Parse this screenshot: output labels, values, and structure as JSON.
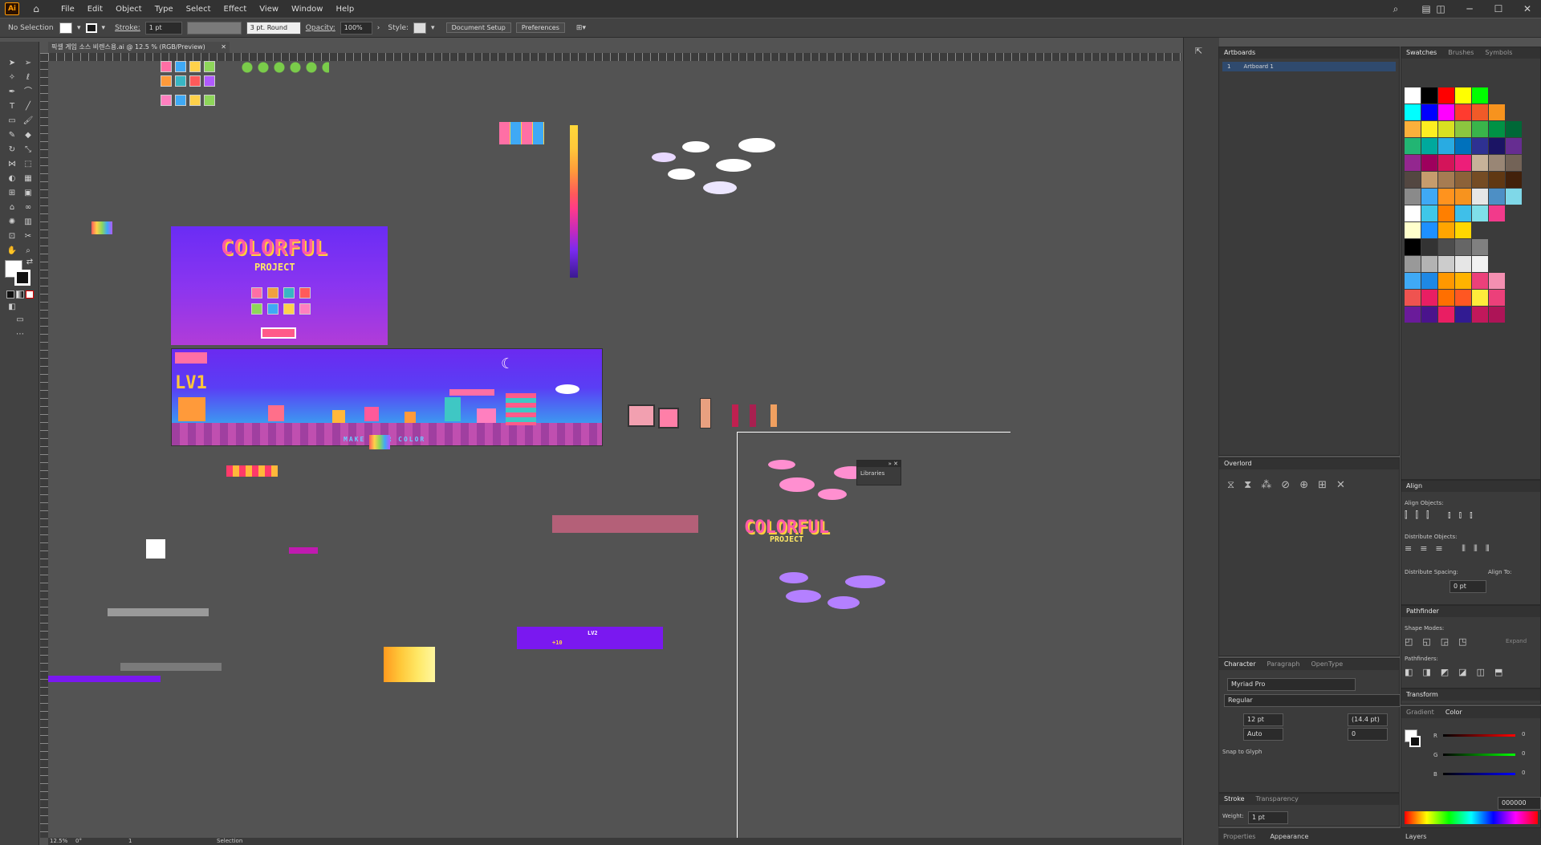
{
  "menubar": {
    "app_icon": "Ai",
    "items": [
      "File",
      "Edit",
      "Object",
      "Type",
      "Select",
      "Effect",
      "View",
      "Window",
      "Help"
    ],
    "right_icons": [
      "search-icon",
      "arrange-icon",
      "workspace-icon",
      "minimize-icon",
      "maximize-icon",
      "close-icon"
    ]
  },
  "control": {
    "selection": "No Selection",
    "stroke_label": "Stroke:",
    "stroke_value": "1 pt",
    "brush": "3 pt. Round",
    "opacity_label": "Opacity:",
    "opacity_value": "100%",
    "style_label": "Style:",
    "doc_setup": "Document Setup",
    "preferences": "Preferences"
  },
  "document": {
    "tab_title": "픽셀 게임 소스 비렌스용.ai @ 12.5 % (RGB/Preview)",
    "zoom": "12.5%",
    "rotation": "0°",
    "artboard_nav": "1",
    "status": "Selection"
  },
  "artboards_panel": {
    "title": "Artboards",
    "rows": [
      {
        "num": "1",
        "name": "Artboard 1"
      }
    ]
  },
  "overlord_panel": {
    "title": "Overlord"
  },
  "libraries_panel": {
    "label": "Libraries"
  },
  "character_panel": {
    "tabs": [
      "Character",
      "Paragraph",
      "OpenType"
    ],
    "font": "Myriad Pro",
    "style": "Regular",
    "size": "12 pt",
    "leading": "(14.4 pt)",
    "kerning": "Auto",
    "tracking": "0",
    "snap": "Snap to Glyph"
  },
  "stroke_panel": {
    "tabs": [
      "Stroke",
      "Transparency"
    ],
    "weight_label": "Weight:",
    "weight": "1 pt"
  },
  "bottom_tabs": [
    "Properties",
    "Appearance"
  ],
  "swatches_panel": {
    "tabs": [
      "Swatches",
      "Brushes",
      "Symbols"
    ],
    "colors": [
      [
        "#ffffff",
        "#000000",
        "#ff0000",
        "#ffff00",
        "#00ff00"
      ],
      [
        "#00ffff",
        "#0000ff",
        "#ff00ff",
        "#ff3b2f",
        "#f05a28",
        "#f7931e"
      ],
      [
        "#fbb03b",
        "#fcee21",
        "#d9e021",
        "#8cc63f",
        "#39b54a",
        "#009245",
        "#006837"
      ],
      [
        "#22b573",
        "#00a99d",
        "#29abe2",
        "#0071bc",
        "#2e3192",
        "#1b1464",
        "#662d91"
      ],
      [
        "#93278f",
        "#9e005d",
        "#d4145a",
        "#ed1e79",
        "#c7b299",
        "#998675",
        "#736357"
      ],
      [
        "#534741",
        "#c69c6d",
        "#a67c52",
        "#8c6239",
        "#754c24",
        "#603813",
        "#42210b"
      ],
      [
        "#8a8a8a",
        "#3fa9f5",
        "#ff931e",
        "#f7931e",
        "#e6e6e6",
        "#4d8fc5",
        "#7fd8e8"
      ],
      [
        "#ffffff",
        "#3fc7e9",
        "#ff7f00",
        "#3fbfe9",
        "#7fdfe9",
        "#f23a8b"
      ],
      [
        "#ffffcc",
        "#1e90ff",
        "#ffa500",
        "#ffd700"
      ],
      [
        "#000000",
        "#333333",
        "#4d4d4d",
        "#666666",
        "#808080"
      ],
      [
        "#999999",
        "#b3b3b3",
        "#cccccc",
        "#e6e6e6",
        "#f2f2f2"
      ],
      [
        "#3fa9f5",
        "#1e88e5",
        "#ff9800",
        "#ffb300",
        "#ec407a",
        "#f48fb1"
      ],
      [
        "#ef5350",
        "#e91e63",
        "#ff6f00",
        "#ff5722",
        "#ffeb3b",
        "#ec407a"
      ],
      [
        "#6a1b9a",
        "#4a148c",
        "#e91e63",
        "#311b92",
        "#c2185b",
        "#ad1457"
      ]
    ]
  },
  "align_panel": {
    "title": "Align",
    "objects": "Align Objects:",
    "distribute": "Distribute Objects:",
    "spacing": "Distribute Spacing:",
    "align_to": "Align To:",
    "value": "0 pt"
  },
  "pathfinder_panel": {
    "title": "Pathfinder",
    "shape_modes": "Shape Modes:",
    "pathfinders": "Pathfinders:",
    "expand": "Expand"
  },
  "transform_panel": {
    "title": "Transform"
  },
  "color_panel": {
    "tabs": [
      "Gradient",
      "Color"
    ],
    "r": "0",
    "g": "0",
    "b": "0",
    "hex": "000000"
  },
  "layers_tab": "Layers",
  "artwork": {
    "game_title": "COLORFUL",
    "game_subtitle": "PROJECT",
    "tagline": "MAKE YOUR COLOR",
    "level": "LV1",
    "level_small": "LV1",
    "level2": "LV2",
    "score": "+10"
  }
}
